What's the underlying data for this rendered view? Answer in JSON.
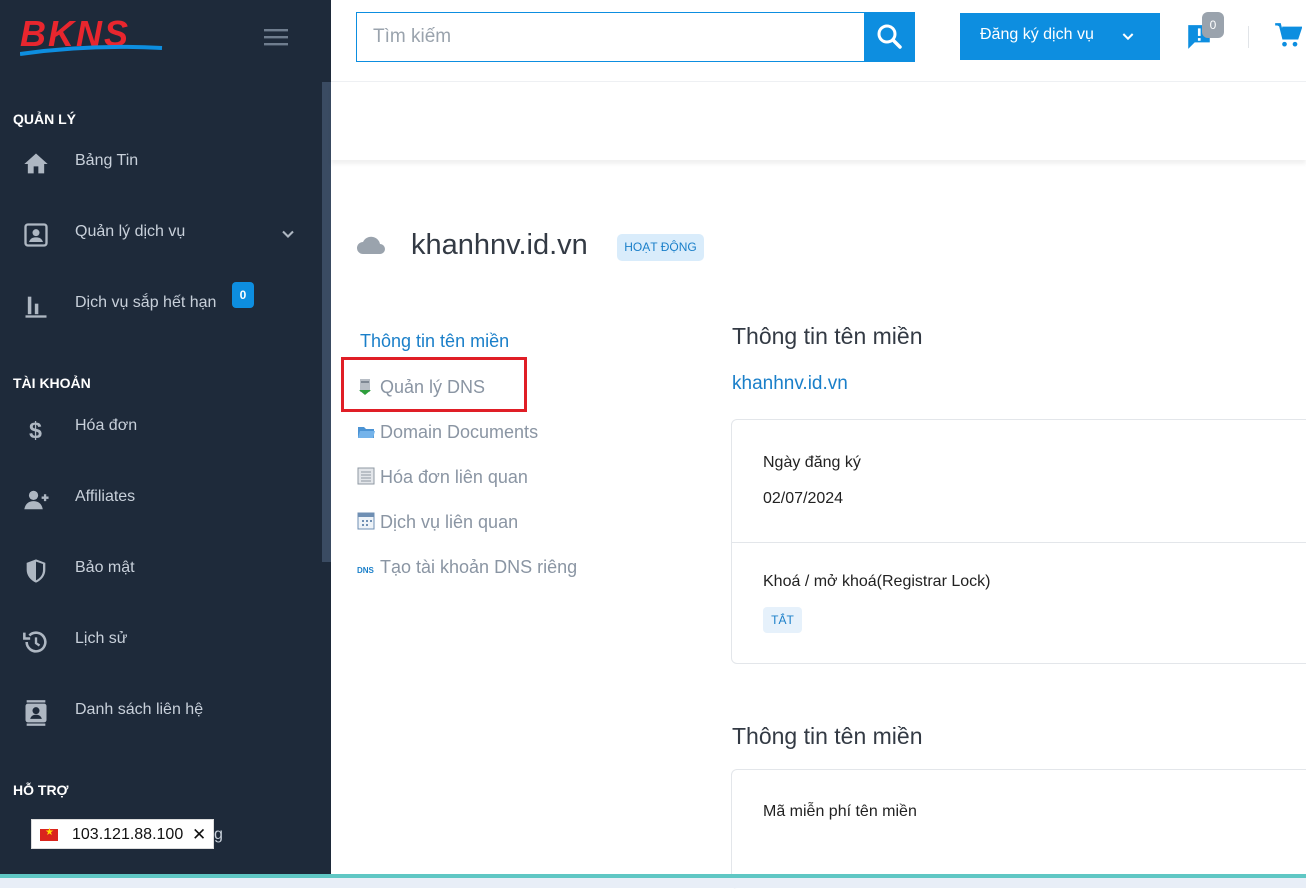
{
  "brand": {
    "logo_text": "BKNS",
    "accent": "#0d8ee0",
    "sidebar_bg": "#1e2a3a",
    "logo_red": "#e8262e",
    "logo_blue": "#0d8ee0"
  },
  "search": {
    "placeholder": "Tìm kiếm",
    "value": ""
  },
  "topbar": {
    "register_label": "Đăng ký dịch vụ",
    "chat_badge": "0"
  },
  "sidebar": {
    "section_manage": "QUẢN LÝ",
    "section_account": "TÀI KHOẢN",
    "section_support": "HỖ TRỢ",
    "items": [
      {
        "label": "Bảng Tin",
        "icon": "home-icon"
      },
      {
        "label": "Quản lý dịch vụ",
        "icon": "id-card-icon"
      },
      {
        "label": "Dịch vụ sắp hết hạn",
        "icon": "bar-chart-icon",
        "badge": "0"
      },
      {
        "label": "Hóa đơn",
        "icon": "dollar-icon"
      },
      {
        "label": "Affiliates",
        "icon": "add-user-icon"
      },
      {
        "label": "Bảo mật",
        "icon": "shield-icon"
      },
      {
        "label": "Lịch sử",
        "icon": "history-icon"
      },
      {
        "label": "Danh sách liên hệ",
        "icon": "contacts-icon"
      }
    ],
    "support_tail": "g"
  },
  "ip_popup": {
    "ip": "103.121.88.100",
    "close": "✕"
  },
  "domain": {
    "name": "khanhnv.id.vn",
    "status": "HOẠT ĐỘNG"
  },
  "side_menu": [
    {
      "label": "Thông tin tên miền",
      "active": true
    },
    {
      "label": "Quản lý DNS",
      "icon": "server-icon"
    },
    {
      "label": "Domain Documents",
      "icon": "folder-icon"
    },
    {
      "label": "Hóa đơn liên quan",
      "icon": "invoice-icon"
    },
    {
      "label": "Dịch vụ liên quan",
      "icon": "calendar-icon"
    },
    {
      "label": "Tạo tài khoản DNS riêng",
      "icon": "dns-icon"
    }
  ],
  "info_section": {
    "heading": "Thông tin tên miền",
    "domain_link": "khanhnv.id.vn",
    "reg_date_label": "Ngày đăng ký",
    "reg_date_value": "02/07/2024",
    "lock_label": "Khoá / mở khoá(Registrar Lock)",
    "lock_value": "TẮT"
  },
  "info_section_2": {
    "heading": "Thông tin tên miền",
    "free_code_label": "Mã miễn phí tên miền"
  }
}
